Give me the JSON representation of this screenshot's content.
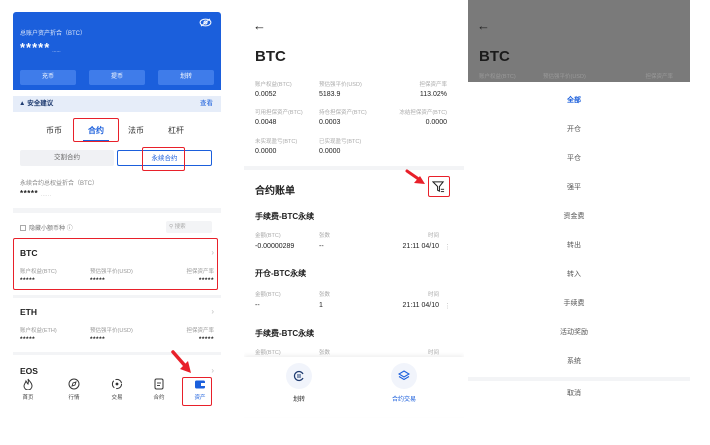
{
  "screen1": {
    "total_assets_label": "总账户资产折合（BTC）",
    "total_assets_value": "*****",
    "total_assets_small": "......",
    "buttons": {
      "deposit": "充币",
      "withdraw": "提币",
      "transfer": "划转"
    },
    "security": {
      "label": "安全建议",
      "action": "查看"
    },
    "tabs": [
      "币币",
      "合约",
      "法币",
      "杠杆"
    ],
    "subtabs": [
      "交割合约",
      "永续合约"
    ],
    "futures_label": "永续合约总权益折合（BTC）",
    "futures_value": "*****",
    "futures_small": "......",
    "hide_small": "隐藏小额币种",
    "search_placeholder": "搜索",
    "coins": [
      {
        "name": "BTC",
        "h1": "账户权益(BTC)",
        "h2": "预估强平价(USD)",
        "h3": "担保资产率",
        "v1": "*****",
        "v2": "*****",
        "v3": "*****"
      },
      {
        "name": "ETH",
        "h1": "账户权益(ETH)",
        "h2": "预估强平价(USD)",
        "h3": "担保资产率",
        "v1": "*****",
        "v2": "*****",
        "v3": "*****"
      },
      {
        "name": "EOS"
      }
    ],
    "nav": [
      "首页",
      "行情",
      "交易",
      "合约",
      "资产"
    ]
  },
  "screen2": {
    "back_arrow": "←",
    "title": "BTC",
    "grid": [
      {
        "label": "账户权益(BTC)",
        "value": "0.0052"
      },
      {
        "label": "预估强平价(USD)",
        "value": "5183.9"
      },
      {
        "label": "担保资产率",
        "value": "113.02%"
      },
      {
        "label": "可用担保资产(BTC)",
        "value": "0.0048"
      },
      {
        "label": "持仓担保资产(BTC)",
        "value": "0.0003"
      },
      {
        "label": "冻结担保资产(BTC)",
        "value": "0.0000"
      },
      {
        "label": "未实现盈亏(BTC)",
        "value": "0.0000"
      },
      {
        "label": "已实现盈亏(BTC)",
        "value": "0.0000"
      }
    ],
    "section_title": "合约账单",
    "records": [
      {
        "title": "手续费-BTC永续",
        "h_amount": "金额(BTC)",
        "h_qty": "张数",
        "h_time": "时间",
        "amount": "-0.00000289",
        "qty": "--",
        "time": "21:11 04/10"
      },
      {
        "title": "开仓-BTC永续",
        "h_amount": "金额(BTC)",
        "h_qty": "张数",
        "h_time": "时间",
        "amount": "--",
        "qty": "1",
        "time": "21:11 04/10"
      },
      {
        "title": "手续费-BTC永续",
        "h_amount": "金额(BTC)",
        "h_qty": "张数",
        "h_time": "时间"
      }
    ],
    "bottom": [
      "划转",
      "合约交易"
    ]
  },
  "screen3": {
    "back_arrow": "←",
    "title": "BTC",
    "ghost": [
      "账户权益(BTC)",
      "预估强平价(USD)",
      "担保资产率"
    ],
    "options": [
      "全部",
      "开仓",
      "平仓",
      "强平",
      "资金费",
      "转出",
      "转入",
      "手续费",
      "活动奖励",
      "系统"
    ],
    "cancel": "取消"
  },
  "colors": {
    "accent": "#1b5fdc",
    "highlight_red": "#e8202a",
    "overlay_gray": "#7a7a7a"
  }
}
